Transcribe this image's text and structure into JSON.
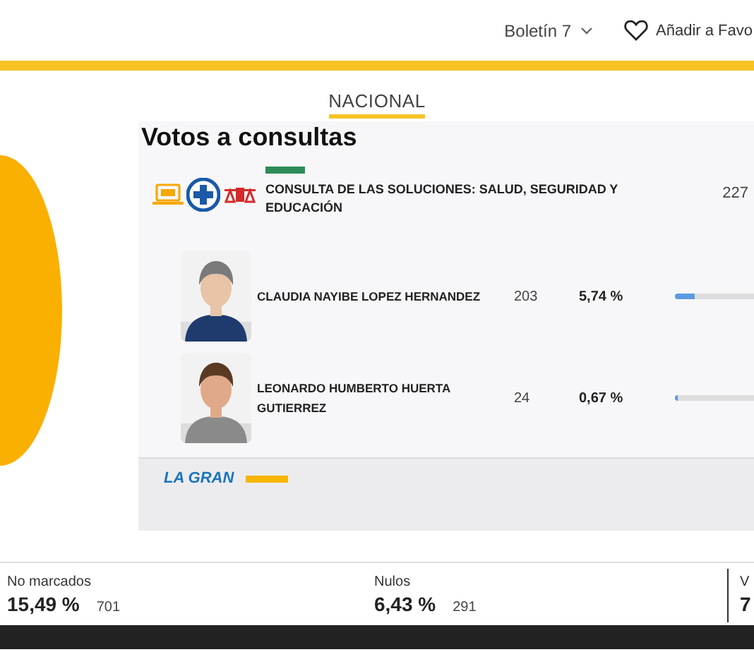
{
  "header": {
    "bulletin_menu": {
      "label": "Boletín 7"
    },
    "favorite_link": {
      "label": "Añadir a Favo"
    }
  },
  "nav_tabs": [
    {
      "label": "NACIONAL",
      "selected": true
    }
  ],
  "section_title": "Votos a consultas",
  "consultation": {
    "name": "CONSULTA DE LAS SOLUCIONES: SALUD, SEGURIDAD Y EDUCACIÓN",
    "votes": "227"
  },
  "candidates": [
    {
      "name": "CLAUDIA NAYIBE LOPEZ HERNANDEZ",
      "votes": "203",
      "percent": "5,74 %",
      "level": 0.0574
    },
    {
      "name": "LEONARDO HUMBERTO HUERTA GUTIERREZ",
      "votes": "24",
      "percent": "0,67 %",
      "level": 0.0067
    }
  ],
  "next_consultation": {
    "label": "LA GRAN"
  },
  "summary": [
    {
      "label": "No marcados",
      "percent": "15,49 %",
      "count": "701"
    },
    {
      "label": "Nulos",
      "percent": "6,43 %",
      "count": "291"
    },
    {
      "label": "V",
      "percent": "7"
    }
  ]
}
